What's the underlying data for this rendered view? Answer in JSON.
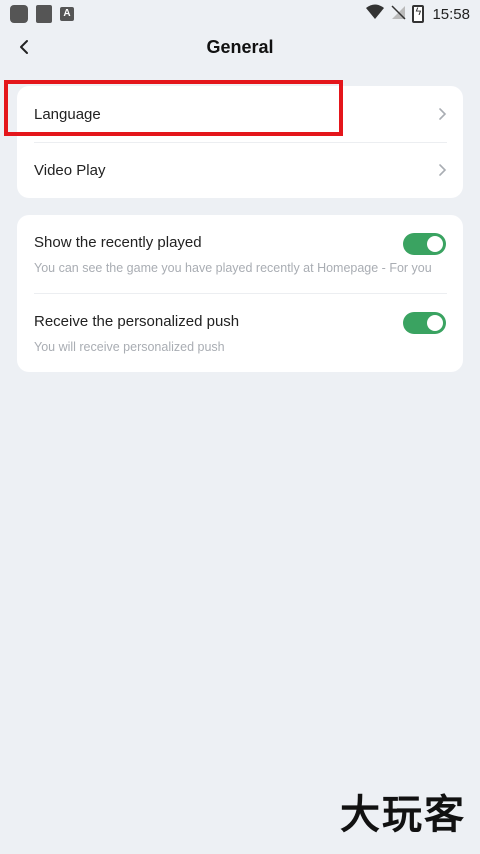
{
  "status_bar": {
    "time": "15:58",
    "icons_left": [
      "app-square-icon",
      "doc-icon",
      "font-a-icon"
    ],
    "icons_right": [
      "wifi-icon",
      "no-signal-icon",
      "battery-charging-icon"
    ]
  },
  "header": {
    "title": "General",
    "back_icon": "chevron-left-icon"
  },
  "settings": {
    "language_label": "Language",
    "video_play_label": "Video Play"
  },
  "toggles": [
    {
      "title": "Show the recently played",
      "subtitle": "You can see the game you have played recently at Homepage - For you",
      "on": true
    },
    {
      "title": "Receive the personalized push",
      "subtitle": "You will receive personalized push",
      "on": true
    }
  ],
  "watermark": "大玩客",
  "colors": {
    "background": "#edf0f4",
    "toggle_on": "#3aa361",
    "highlight": "#e4161b"
  }
}
